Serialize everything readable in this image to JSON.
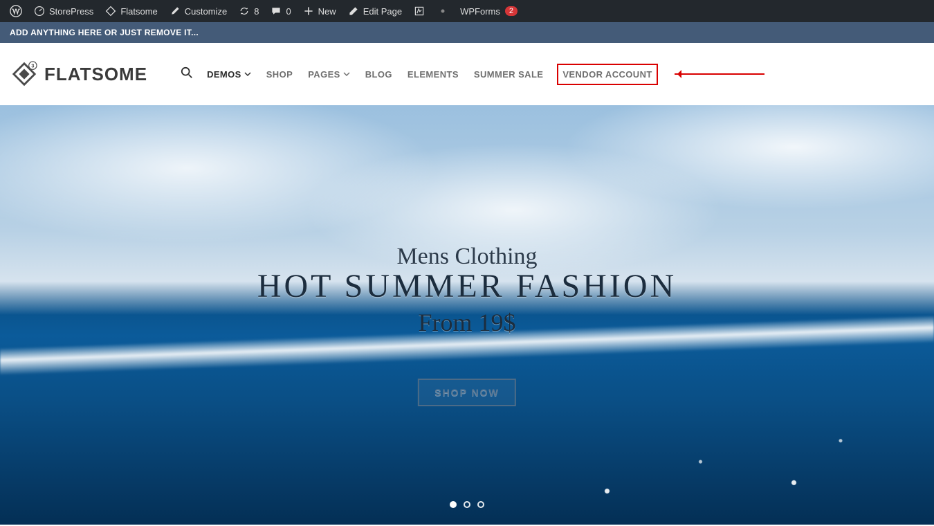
{
  "admin_bar": {
    "site": "StorePress",
    "theme": "Flatsome",
    "customize": "Customize",
    "updates": "8",
    "comments": "0",
    "new": "New",
    "edit": "Edit Page",
    "wpforms": "WPForms",
    "wpforms_badge": "2"
  },
  "notice": "ADD ANYTHING HERE OR JUST REMOVE IT...",
  "logo": {
    "text": "FLATSOME",
    "badge": "3"
  },
  "nav": {
    "items": [
      {
        "label": "DEMOS",
        "has_dropdown": true,
        "active": true
      },
      {
        "label": "SHOP",
        "has_dropdown": false
      },
      {
        "label": "PAGES",
        "has_dropdown": true
      },
      {
        "label": "BLOG",
        "has_dropdown": false
      },
      {
        "label": "ELEMENTS",
        "has_dropdown": false
      },
      {
        "label": "SUMMER SALE",
        "has_dropdown": false
      },
      {
        "label": "VENDOR ACCOUNT",
        "has_dropdown": false,
        "highlighted": true
      }
    ]
  },
  "hero": {
    "subtitle": "Mens Clothing",
    "title": "HOT SUMMER FASHION",
    "price_line": "From 19$",
    "cta": "SHOP NOW",
    "dots": 3,
    "active_dot": 0
  }
}
